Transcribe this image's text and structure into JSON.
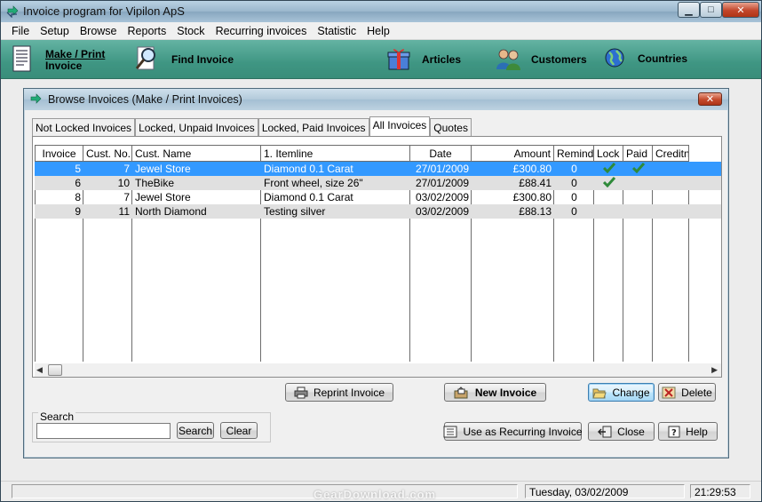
{
  "window": {
    "title": "Invoice program for Vipilon ApS",
    "minimize_glyph": "▁",
    "maximize_glyph": "□",
    "close_glyph": "✕"
  },
  "menu": [
    "File",
    "Setup",
    "Browse",
    "Reports",
    "Stock",
    "Recurring invoices",
    "Statistic",
    "Help"
  ],
  "toolbar": {
    "make_print_line1": "Make / Print",
    "make_print_line2": "Invoice",
    "find_invoice": "Find Invoice",
    "articles": "Articles",
    "customers": "Customers",
    "countries": "Countries"
  },
  "dialog": {
    "title": "Browse Invoices (Make / Print Invoices)",
    "close_glyph": "✕",
    "tabs": [
      "Not Locked Invoices",
      "Locked, Unpaid Invoices",
      "Locked, Paid Invoices",
      "All Invoices",
      "Quotes"
    ],
    "active_tab": "All Invoices",
    "columns": [
      "Invoice",
      "Cust. No.",
      "Cust. Name",
      "1. Itemline",
      "Date",
      "Amount",
      "Remind",
      "Lock",
      "Paid",
      "Creditnote"
    ],
    "rows": [
      {
        "invoice": "5",
        "cust_no": "7",
        "cust_name": "Jewel Store",
        "itemline": "Diamond 0.1 Carat",
        "date": "27/01/2009",
        "amount": "£300.80",
        "remind": "0",
        "lock": true,
        "paid": true,
        "creditnote": ""
      },
      {
        "invoice": "6",
        "cust_no": "10",
        "cust_name": "TheBike",
        "itemline": "Front wheel, size 26\"",
        "date": "27/01/2009",
        "amount": "£88.41",
        "remind": "0",
        "lock": true,
        "paid": false,
        "creditnote": ""
      },
      {
        "invoice": "8",
        "cust_no": "7",
        "cust_name": "Jewel Store",
        "itemline": "Diamond 0.1 Carat",
        "date": "03/02/2009",
        "amount": "£300.80",
        "remind": "0",
        "lock": false,
        "paid": false,
        "creditnote": ""
      },
      {
        "invoice": "9",
        "cust_no": "11",
        "cust_name": "North Diamond",
        "itemline": "Testing silver",
        "date": "03/02/2009",
        "amount": "£88.13",
        "remind": "0",
        "lock": false,
        "paid": false,
        "creditnote": ""
      }
    ],
    "buttons": {
      "reprint": "Reprint Invoice",
      "new_invoice": "New Invoice",
      "change": "Change",
      "delete": "Delete",
      "recurring": "Use as Recurring Invoice",
      "close": "Close",
      "help": "Help",
      "search": "Search",
      "clear": "Clear"
    },
    "search": {
      "label": "Search",
      "value": ""
    }
  },
  "status": {
    "date": "Tuesday, 03/02/2009",
    "time": "21:29:53"
  },
  "watermark": "GearDownload.com",
  "colors": {
    "toolbar": "#3f9683",
    "selection": "#3399ff",
    "alt_row": "#e0e0e0",
    "check": "#2f8a3a"
  }
}
